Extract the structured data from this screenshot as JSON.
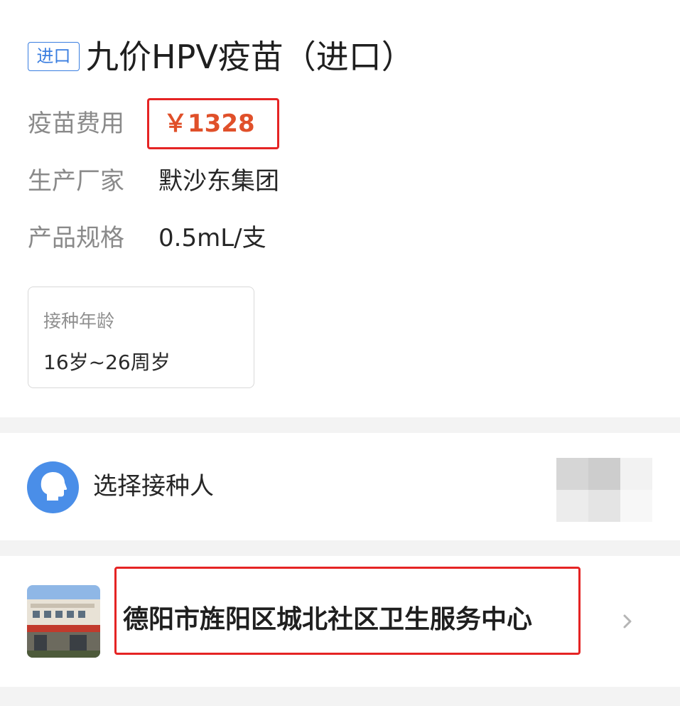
{
  "vaccine": {
    "badge": "进口",
    "title": "九价HPV疫苗（进口）",
    "price_label": "疫苗费用",
    "price": "￥1328",
    "manufacturer_label": "生产厂家",
    "manufacturer": "默沙东集团",
    "spec_label": "产品规格",
    "spec": "0.5mL/支",
    "age_label": "接种年龄",
    "age": "16岁~26周岁"
  },
  "person": {
    "label": "选择接种人",
    "icon": "person-head-icon"
  },
  "clinic": {
    "name": "德阳市旌阳区城北社区卫生服务中心",
    "chevron_icon": "chevron-right-icon"
  },
  "colors": {
    "accent": "#3a7ee0",
    "price": "#e0502a",
    "highlight_box": "#e52424"
  }
}
